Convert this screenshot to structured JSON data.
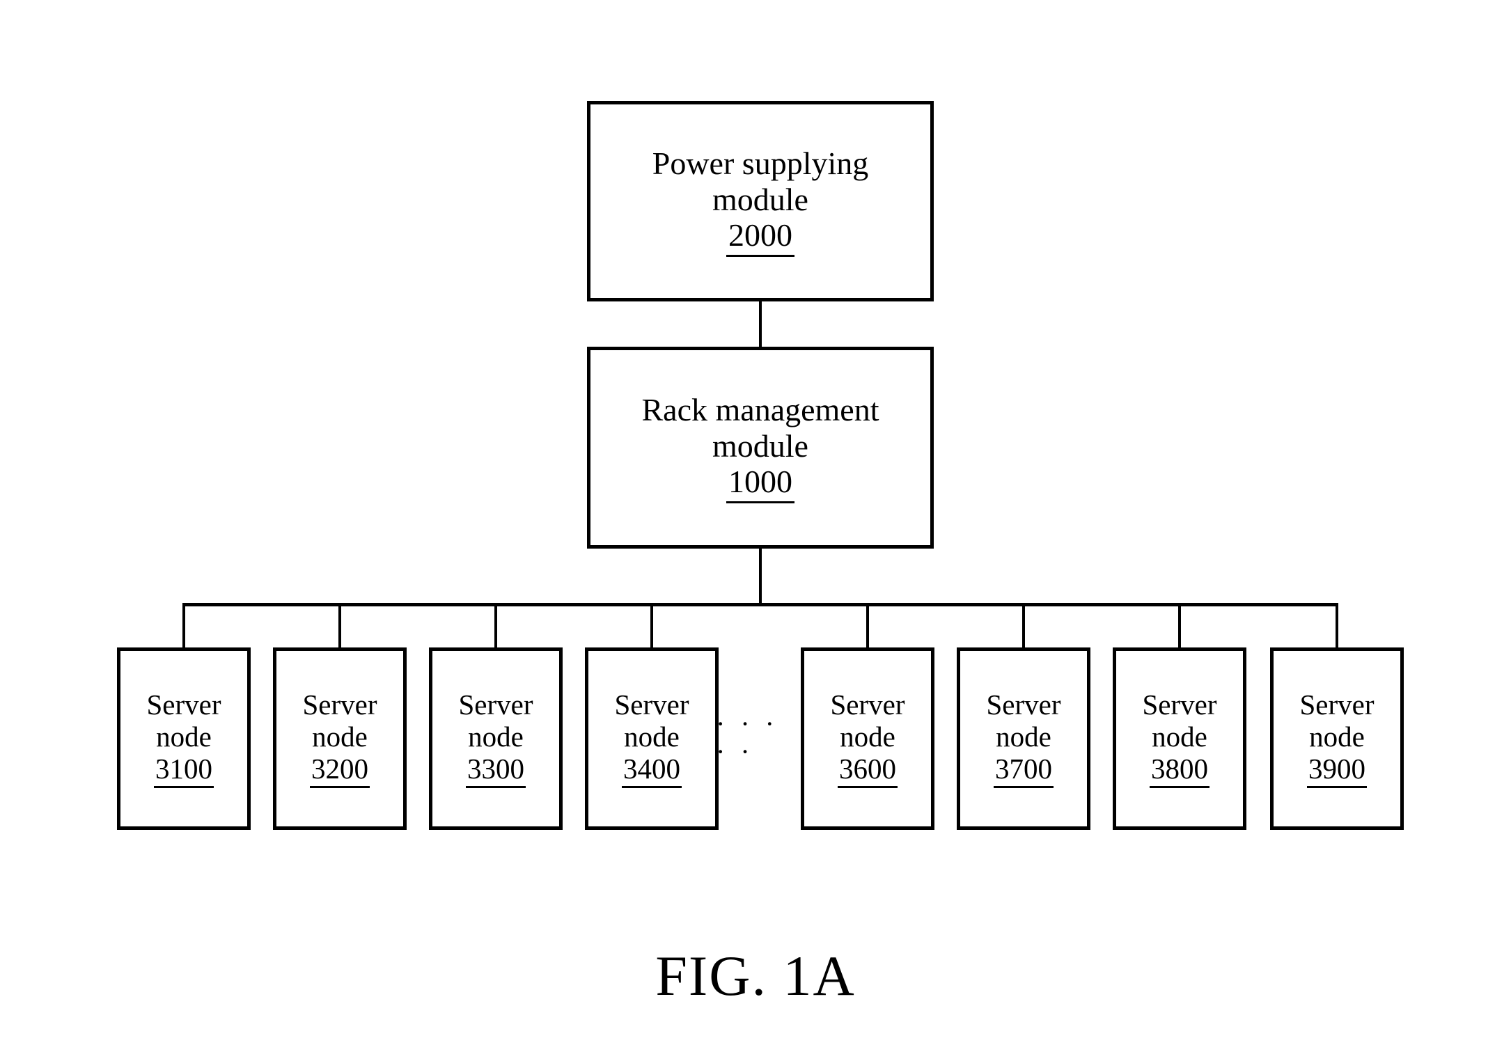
{
  "figure": {
    "caption": "FIG. 1A",
    "type": "block-diagram"
  },
  "modules": {
    "power": {
      "title": "Power supplying\nmodule",
      "ref": "2000"
    },
    "rack": {
      "title": "Rack management\nmodule",
      "ref": "1000"
    }
  },
  "server_nodes": [
    {
      "label": "Server\nnode",
      "ref": "3100"
    },
    {
      "label": "Server\nnode",
      "ref": "3200"
    },
    {
      "label": "Server\nnode",
      "ref": "3300"
    },
    {
      "label": "Server\nnode",
      "ref": "3400"
    },
    {
      "label": "Server\nnode",
      "ref": "3600"
    },
    {
      "label": "Server\nnode",
      "ref": "3700"
    },
    {
      "label": "Server\nnode",
      "ref": "3800"
    },
    {
      "label": "Server\nnode",
      "ref": "3900"
    }
  ],
  "ellipsis": {
    "text": "· · · · ·",
    "dot_count": 5
  },
  "colors": {
    "line": "#000000",
    "background": "#ffffff",
    "text": "#000000"
  }
}
